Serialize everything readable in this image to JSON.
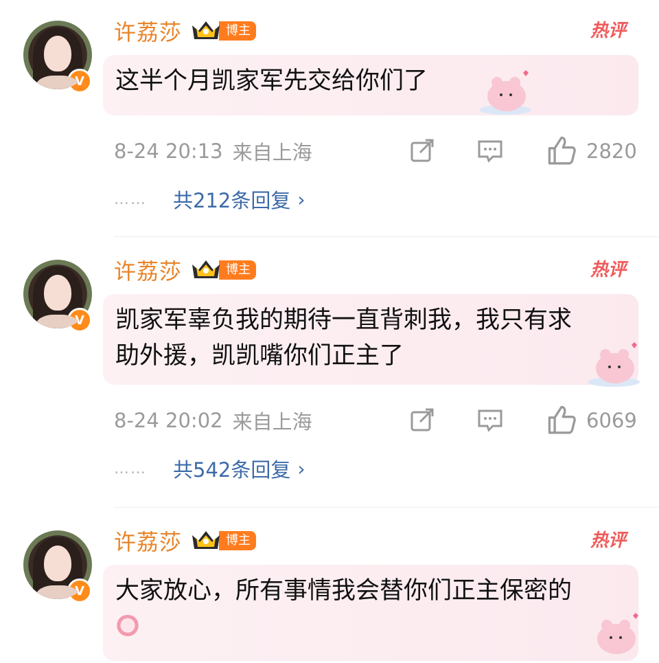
{
  "comments": [
    {
      "username": "许荔莎",
      "role": "博主",
      "hot": "热评",
      "text": "这半个月凯家军先交给你们了",
      "time": "8-24 20:13",
      "location": "来自上海",
      "likes": "2820",
      "replies": "共212条回复"
    },
    {
      "username": "许荔莎",
      "role": "博主",
      "hot": "热评",
      "text": "凯家军辜负我的期待一直背刺我，我只有求助外援，凯凯嘴你们正主了",
      "time": "8-24 20:02",
      "location": "来自上海",
      "likes": "6069",
      "replies": "共542条回复"
    },
    {
      "username": "许荔莎",
      "role": "博主",
      "hot": "热评",
      "text": "大家放心，所有事情我会替你们正主保密的",
      "time": "",
      "location": "",
      "likes": "",
      "replies": ""
    }
  ],
  "reply_dots": "……",
  "verified_mark": "V",
  "accent_colors": {
    "username": "#e8842a",
    "hot": "#f05a5a",
    "link": "#3c6aa8",
    "meta": "#9a9a9a"
  }
}
